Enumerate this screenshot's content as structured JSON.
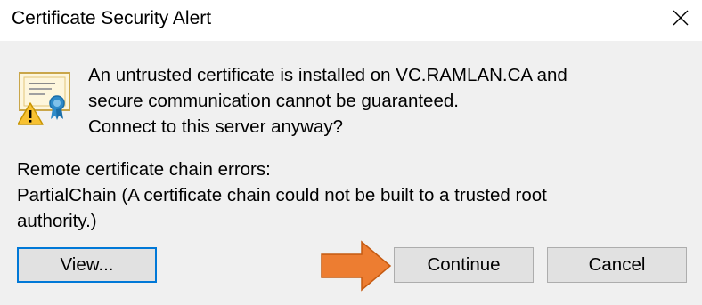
{
  "window": {
    "title": "Certificate Security Alert",
    "close_icon": "close-icon"
  },
  "message": {
    "line1": "An untrusted certificate is installed on VC.RAMLAN.CA and",
    "line2": "secure communication cannot be guaranteed.",
    "line3": "Connect to this server anyway?"
  },
  "errors": {
    "heading": "Remote certificate chain errors:",
    "line1": "PartialChain (A certificate chain could not be built to a trusted root",
    "line2": "authority.)"
  },
  "buttons": {
    "view_label": "View...",
    "continue_label": "Continue",
    "cancel_label": "Cancel"
  },
  "colors": {
    "accent": "#0078d7",
    "annotation_arrow": "#ed7d31",
    "client_bg": "#f0f0f0",
    "button_bg": "#e1e1e1"
  },
  "icons": {
    "certificate": "certificate-warning-icon",
    "annotation": "arrow-right-icon"
  }
}
